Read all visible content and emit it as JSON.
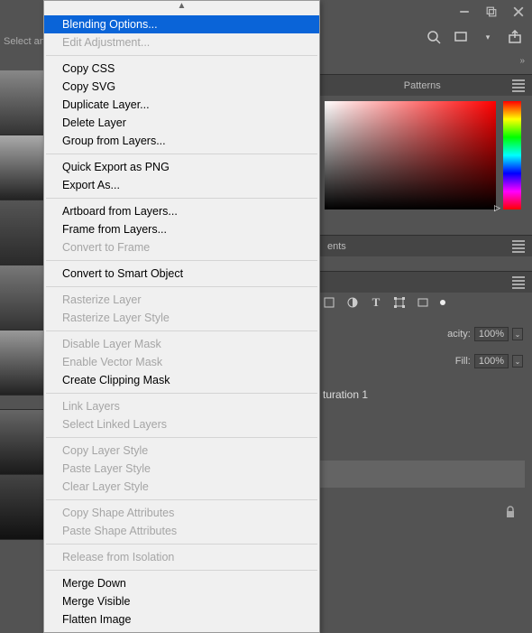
{
  "window_controls": {
    "minimize": "minimize",
    "maximize": "maximize",
    "close": "close"
  },
  "toolbar": {
    "select_hint": "Select and"
  },
  "panels": {
    "patterns_tab": "Patterns",
    "adjustments_tab_suffix": "ents"
  },
  "layers": {
    "opacity_label_suffix": "acity:",
    "opacity_value": "100%",
    "fill_label": "Fill:",
    "fill_value": "100%",
    "entry1_suffix": "turation 1"
  },
  "context_menu": {
    "groups": [
      [
        {
          "label": "Blending Options...",
          "enabled": true,
          "highlight": true
        },
        {
          "label": "Edit Adjustment...",
          "enabled": false
        }
      ],
      [
        {
          "label": "Copy CSS",
          "enabled": true
        },
        {
          "label": "Copy SVG",
          "enabled": true
        },
        {
          "label": "Duplicate Layer...",
          "enabled": true
        },
        {
          "label": "Delete Layer",
          "enabled": true
        },
        {
          "label": "Group from Layers...",
          "enabled": true
        }
      ],
      [
        {
          "label": "Quick Export as PNG",
          "enabled": true
        },
        {
          "label": "Export As...",
          "enabled": true
        }
      ],
      [
        {
          "label": "Artboard from Layers...",
          "enabled": true
        },
        {
          "label": "Frame from Layers...",
          "enabled": true
        },
        {
          "label": "Convert to Frame",
          "enabled": false
        }
      ],
      [
        {
          "label": "Convert to Smart Object",
          "enabled": true
        }
      ],
      [
        {
          "label": "Rasterize Layer",
          "enabled": false
        },
        {
          "label": "Rasterize Layer Style",
          "enabled": false
        }
      ],
      [
        {
          "label": "Disable Layer Mask",
          "enabled": false
        },
        {
          "label": "Enable Vector Mask",
          "enabled": false
        },
        {
          "label": "Create Clipping Mask",
          "enabled": true
        }
      ],
      [
        {
          "label": "Link Layers",
          "enabled": false
        },
        {
          "label": "Select Linked Layers",
          "enabled": false
        }
      ],
      [
        {
          "label": "Copy Layer Style",
          "enabled": false
        },
        {
          "label": "Paste Layer Style",
          "enabled": false
        },
        {
          "label": "Clear Layer Style",
          "enabled": false
        }
      ],
      [
        {
          "label": "Copy Shape Attributes",
          "enabled": false
        },
        {
          "label": "Paste Shape Attributes",
          "enabled": false
        }
      ],
      [
        {
          "label": "Release from Isolation",
          "enabled": false
        }
      ],
      [
        {
          "label": "Merge Down",
          "enabled": true
        },
        {
          "label": "Merge Visible",
          "enabled": true
        },
        {
          "label": "Flatten Image",
          "enabled": true
        }
      ]
    ]
  }
}
